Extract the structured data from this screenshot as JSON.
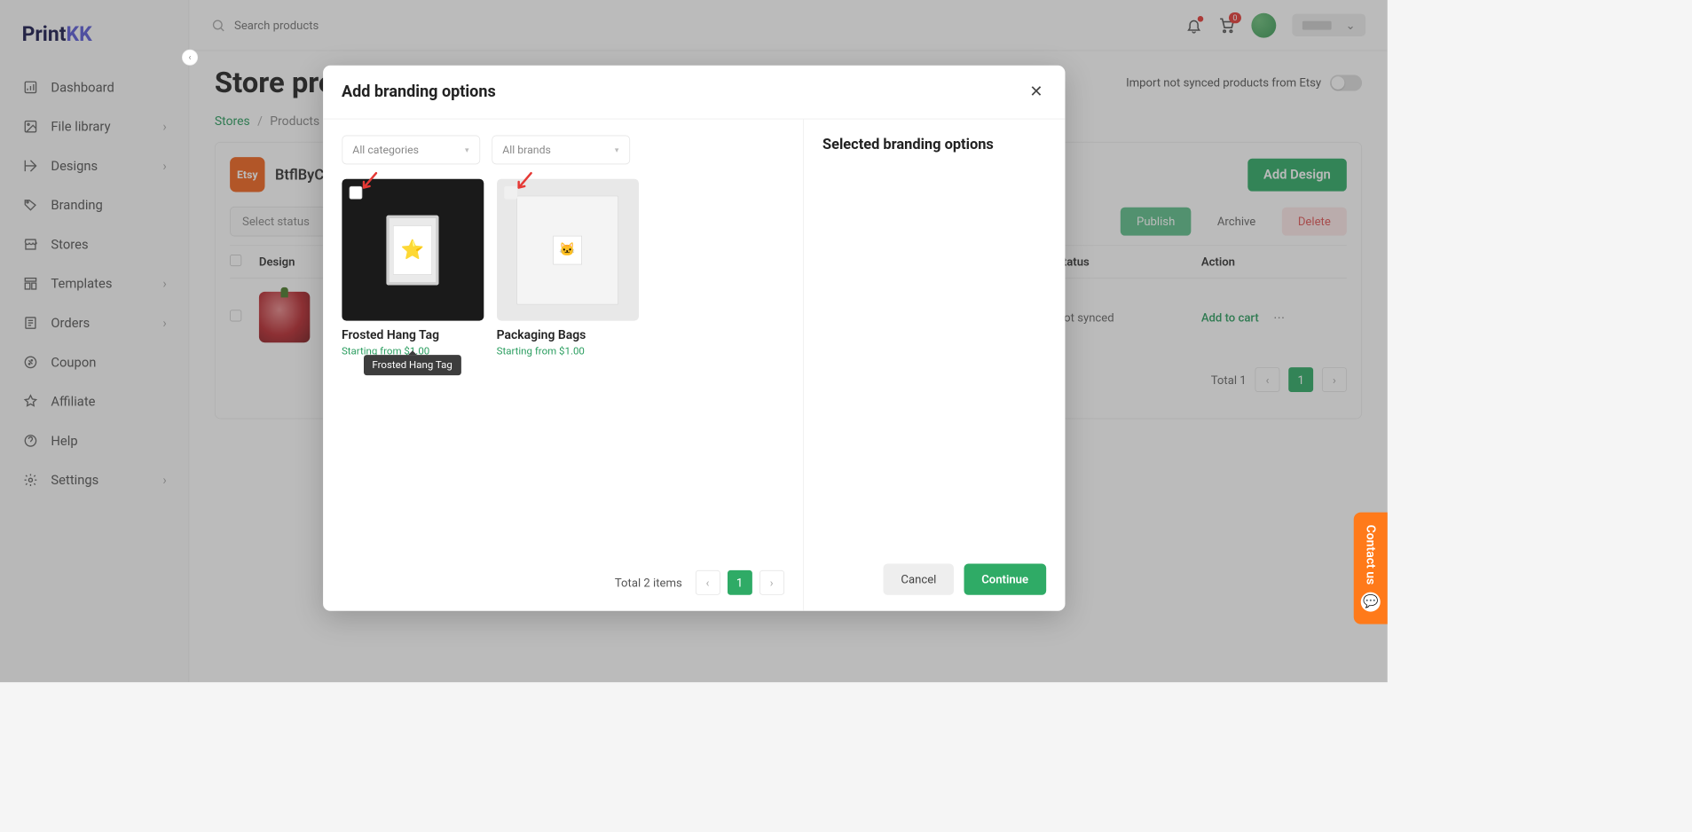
{
  "logo": {
    "part1": "Print",
    "part2": "KK"
  },
  "sidebar": {
    "items": [
      {
        "label": "Dashboard",
        "has_chevron": false
      },
      {
        "label": "File library",
        "has_chevron": true
      },
      {
        "label": "Designs",
        "has_chevron": true
      },
      {
        "label": "Branding",
        "has_chevron": false
      },
      {
        "label": "Stores",
        "has_chevron": false
      },
      {
        "label": "Templates",
        "has_chevron": true
      },
      {
        "label": "Orders",
        "has_chevron": true
      },
      {
        "label": "Coupon",
        "has_chevron": false
      },
      {
        "label": "Affiliate",
        "has_chevron": false
      },
      {
        "label": "Help",
        "has_chevron": false
      },
      {
        "label": "Settings",
        "has_chevron": true
      }
    ]
  },
  "header": {
    "search_placeholder": "Search products",
    "cart_badge": "0"
  },
  "page": {
    "title": "Store products",
    "import_label": "Import not synced products from Etsy",
    "breadcrumb": {
      "stores": "Stores",
      "products": "Products"
    },
    "store_name": "BtflByCe",
    "add_design": "Add Design",
    "select_status": "Select status",
    "publish": "Publish",
    "archive": "Archive",
    "delete": "Delete",
    "col_design": "Design",
    "col_status": "Status",
    "col_action": "Action",
    "row_status": "Not synced",
    "row_action": "Add to cart",
    "pager_total": "Total 1",
    "pager_page": "1"
  },
  "modal": {
    "title": "Add branding options",
    "dd_categories": "All categories",
    "dd_brands": "All brands",
    "right_title": "Selected branding options",
    "options": [
      {
        "name": "Frosted Hang Tag",
        "price": "Starting from $1.00"
      },
      {
        "name": "Packaging Bags",
        "price": "Starting from $1.00"
      }
    ],
    "tooltip": "Frosted Hang Tag",
    "total": "Total 2 items",
    "page": "1",
    "cancel": "Cancel",
    "continue": "Continue"
  },
  "contact": "Contact us"
}
